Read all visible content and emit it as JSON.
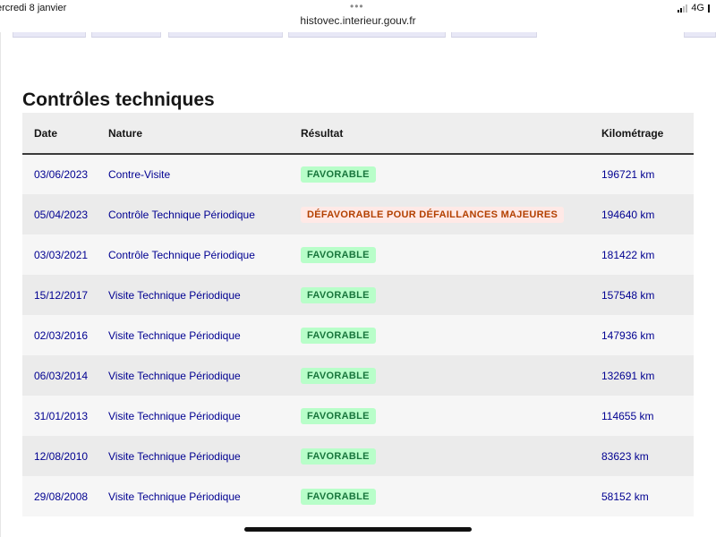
{
  "status_bar": {
    "date": "ercredi 8 janvier",
    "dots": "•••",
    "network": "4G"
  },
  "browser": {
    "url": "histovec.interieur.gouv.fr"
  },
  "page": {
    "title": "Contrôles techniques"
  },
  "table": {
    "headers": {
      "date": "Date",
      "nature": "Nature",
      "result": "Résultat",
      "km": "Kilométrage"
    },
    "rows": [
      {
        "date": "03/06/2023",
        "nature": "Contre-Visite",
        "result": "FAVORABLE",
        "km": "196721 km"
      },
      {
        "date": "05/04/2023",
        "nature": "Contrôle Technique Périodique",
        "result": "DÉFAVORABLE POUR DÉFAILLANCES MAJEURES",
        "km": "194640 km"
      },
      {
        "date": "03/03/2021",
        "nature": "Contrôle Technique Périodique",
        "result": "FAVORABLE",
        "km": "181422 km"
      },
      {
        "date": "15/12/2017",
        "nature": "Visite Technique Périodique",
        "result": "FAVORABLE",
        "km": "157548 km"
      },
      {
        "date": "02/03/2016",
        "nature": "Visite Technique Périodique",
        "result": "FAVORABLE",
        "km": "147936 km"
      },
      {
        "date": "06/03/2014",
        "nature": "Visite Technique Périodique",
        "result": "FAVORABLE",
        "km": "132691 km"
      },
      {
        "date": "31/01/2013",
        "nature": "Visite Technique Périodique",
        "result": "FAVORABLE",
        "km": "114655 km"
      },
      {
        "date": "12/08/2010",
        "nature": "Visite Technique Périodique",
        "result": "FAVORABLE",
        "km": "83623 km"
      },
      {
        "date": "29/08/2008",
        "nature": "Visite Technique Périodique",
        "result": "FAVORABLE",
        "km": "58152 km"
      }
    ]
  },
  "colors": {
    "link_blue": "#000091",
    "favorable_bg": "#b8fec9",
    "favorable_text": "#18753c",
    "defavorable_bg": "#ffe9e6",
    "defavorable_text": "#b34000"
  }
}
